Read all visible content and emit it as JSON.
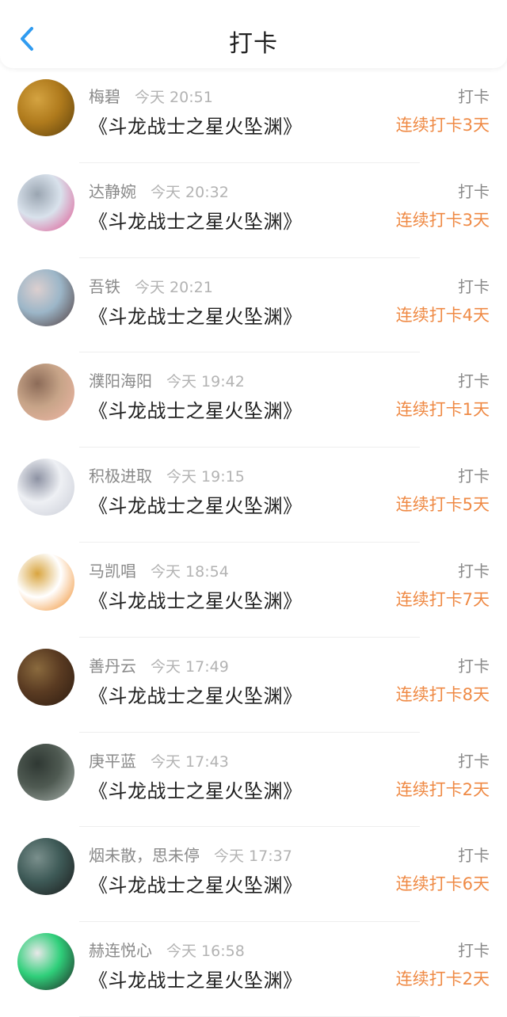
{
  "header": {
    "title": "打卡",
    "back_icon": "chevron-left-icon",
    "accent_color": "#2f9bf0"
  },
  "items": [
    {
      "name": "梅碧",
      "time": "今天 20:51",
      "book": "《斗龙战士之星火坠渊》",
      "action": "打卡",
      "streak": "连续打卡3天",
      "avatar_colors": [
        "#b07b1d",
        "#5b3f0b",
        "#d4a341"
      ]
    },
    {
      "name": "达静婉",
      "time": "今天 20:32",
      "book": "《斗龙战士之星火坠渊》",
      "action": "打卡",
      "streak": "连续打卡3天",
      "avatar_colors": [
        "#d9e2ec",
        "#e0528f",
        "#9aa5b1"
      ]
    },
    {
      "name": "吾铁",
      "time": "今天 20:21",
      "book": "《斗龙战士之星火坠渊》",
      "action": "打卡",
      "streak": "连续打卡4天",
      "avatar_colors": [
        "#9cb6c8",
        "#4f3a3a",
        "#dccfcf"
      ]
    },
    {
      "name": "濮阳海阳",
      "time": "今天 19:42",
      "book": "《斗龙战士之星火坠渊》",
      "action": "打卡",
      "streak": "连续打卡1天",
      "avatar_colors": [
        "#c7a488",
        "#f0b6a6",
        "#8c6b58"
      ]
    },
    {
      "name": "积极进取",
      "time": "今天 19:15",
      "book": "《斗龙战士之星火坠渊》",
      "action": "打卡",
      "streak": "连续打卡5天",
      "avatar_colors": [
        "#eef0f4",
        "#c9ccd6",
        "#8d92a3"
      ]
    },
    {
      "name": "马凯唱",
      "time": "今天 18:54",
      "book": "《斗龙战士之星火坠渊》",
      "action": "打卡",
      "streak": "连续打卡7天",
      "avatar_colors": [
        "#ffffff",
        "#f08a24",
        "#d9a540"
      ]
    },
    {
      "name": "善丹云",
      "time": "今天 17:49",
      "book": "《斗龙战士之星火坠渊》",
      "action": "打卡",
      "streak": "连续打卡8天",
      "avatar_colors": [
        "#5a3b22",
        "#2c1b10",
        "#8a6a3e"
      ]
    },
    {
      "name": "庚平蓝",
      "time": "今天 17:43",
      "book": "《斗龙战士之星火坠渊》",
      "action": "打卡",
      "streak": "连续打卡2天",
      "avatar_colors": [
        "#4f5a52",
        "#a9b2ad",
        "#2f3833"
      ]
    },
    {
      "name": "烟未散，思未停",
      "time": "今天 17:37",
      "book": "《斗龙战士之星火坠渊》",
      "action": "打卡",
      "streak": "连续打卡6天",
      "avatar_colors": [
        "#3e5a57",
        "#1a1a1a",
        "#7a8f8c"
      ]
    },
    {
      "name": "赫连悦心",
      "time": "今天 16:58",
      "book": "《斗龙战士之星火坠渊》",
      "action": "打卡",
      "streak": "连续打卡2天",
      "avatar_colors": [
        "#2fcf7a",
        "#202020",
        "#e8e8e8"
      ]
    }
  ]
}
